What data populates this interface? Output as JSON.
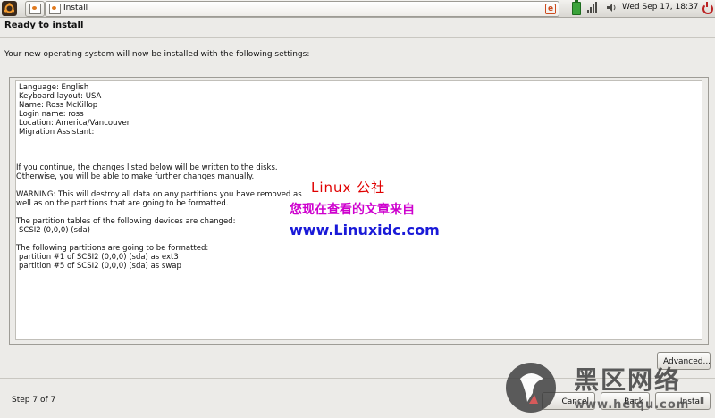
{
  "panel": {
    "app_title": "Install",
    "clock": "Wed Sep 17, 18:37"
  },
  "window": {
    "title": "Ready to install",
    "intro": "Your new operating system will now be installed with the following settings:"
  },
  "summary": {
    "settings": [
      "Language: English",
      "Keyboard layout: USA",
      "Name: Ross McKillop",
      "Login name: ross",
      "Location: America/Vancouver",
      "Migration Assistant:"
    ],
    "continue_lines": [
      "If you continue, the changes listed below will be written to the disks.",
      "Otherwise, you will be able to make further changes manually."
    ],
    "warning_lines": [
      "WARNING: This will destroy all data on any partitions you have removed as",
      "well as on the partitions that are going to be formatted."
    ],
    "partition_tables_heading": "The partition tables of the following devices are changed:",
    "partition_tables_device": "SCSI2 (0,0,0) (sda)",
    "format_heading": "The following partitions are going to be formatted:",
    "format_items": [
      "partition #1 of SCSI2 (0,0,0) (sda) as ext3",
      "partition #5 of SCSI2 (0,0,0) (sda) as swap"
    ]
  },
  "watermark": {
    "line1": "Linux 公社",
    "line2": "您现在查看的文章来自",
    "line3": "www.Linuxidc.com"
  },
  "footer": {
    "advanced_label": "Advanced...",
    "step": "Step 7 of 7",
    "cancel_label": "Cancel",
    "back_label": "Back",
    "install_label": "Install"
  },
  "logo_overlay": {
    "chinese": "黑区网络",
    "url": "www.heiqu.com"
  }
}
